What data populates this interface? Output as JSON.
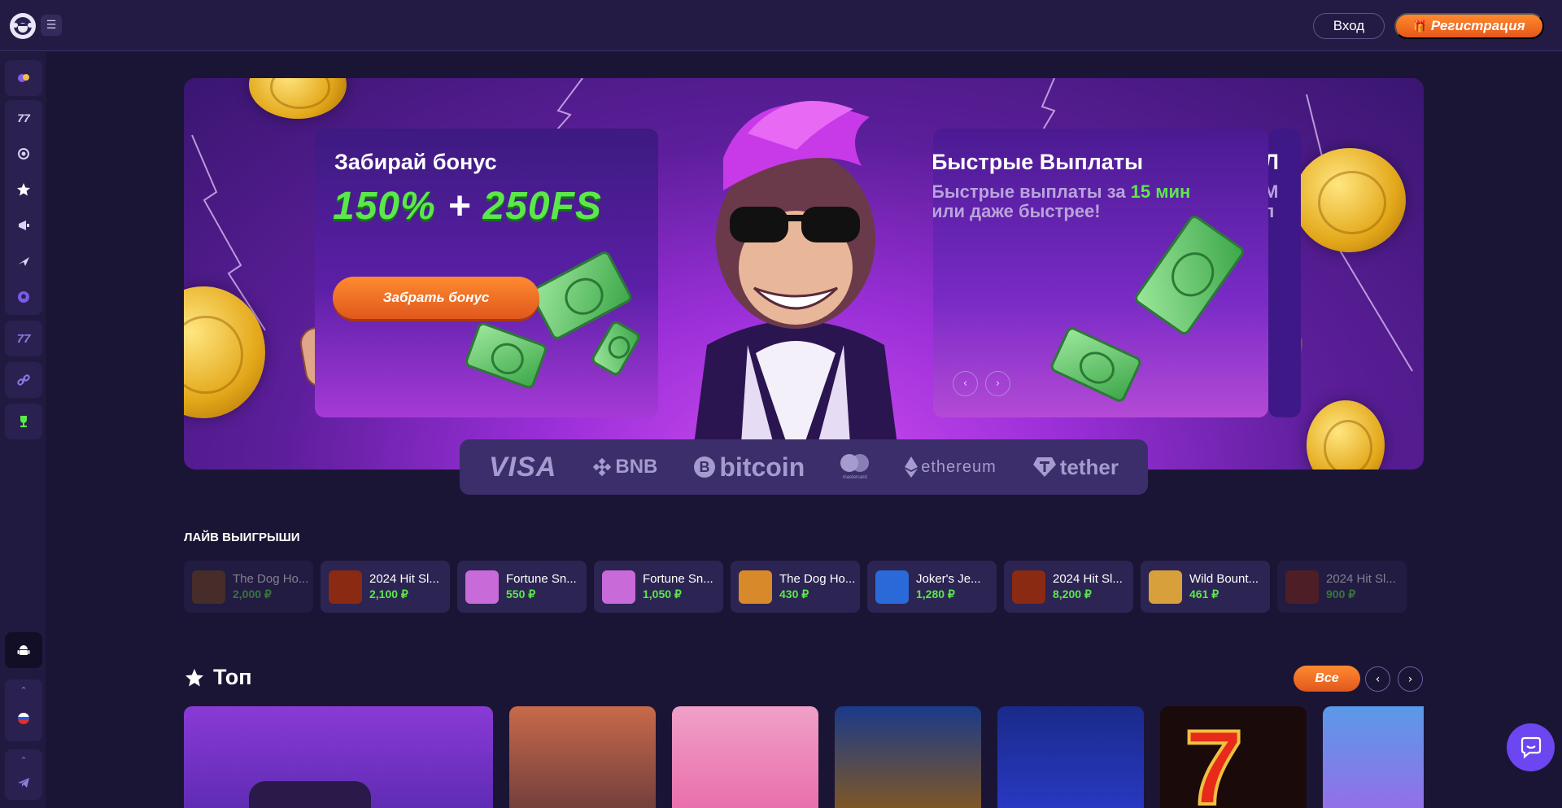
{
  "header": {
    "menu_icon": "hamburger-icon",
    "login_label": "Вход",
    "register_label": "Регистрация",
    "register_icon": "gift-icon"
  },
  "sidebar": {
    "items": [
      {
        "icon": "casino-chips-icon"
      },
      {
        "icon": "slots-777-icon"
      },
      {
        "icon": "live-casino-icon"
      },
      {
        "icon": "star-icon"
      },
      {
        "icon": "promotions-icon"
      },
      {
        "icon": "aviator-icon"
      },
      {
        "icon": "sports-ball-icon"
      },
      {
        "icon": "slots-77-icon"
      },
      {
        "icon": "link-icon"
      },
      {
        "icon": "trophy-icon"
      }
    ],
    "android_icon": "android-icon",
    "language_icon": "russian-flag-icon",
    "telegram_icon": "telegram-icon"
  },
  "banner": {
    "slide1": {
      "title": "Забирай бонус",
      "bonus_main": "150%",
      "bonus_plus": "+",
      "bonus_fs": "250FS",
      "cta": "Забрать бонус"
    },
    "slide2": {
      "title": "Быстрые Выплаты",
      "subtitle_part1": "Быстрые выплаты за ",
      "subtitle_highlight": "15 мин",
      "subtitle_part2": "или даже быстрее!"
    },
    "slide3_peek": {
      "title": "Л",
      "line1": "М",
      "line2": "п"
    },
    "arrows": {
      "prev": "‹",
      "next": "›"
    }
  },
  "payments": [
    {
      "name": "VISA"
    },
    {
      "name": "BNB"
    },
    {
      "name": "bitcoin"
    },
    {
      "name": "mastercard"
    },
    {
      "name": "ethereum"
    },
    {
      "name": "tether"
    }
  ],
  "live_wins": {
    "title": "ЛАЙВ ВЫИГРЫШИ",
    "items": [
      {
        "game": "The Dog Ho...",
        "amount": "2,000 ₽",
        "color": "#7a4a1e"
      },
      {
        "game": "2024 Hit Sl...",
        "amount": "2,100 ₽",
        "color": "#8a2a12"
      },
      {
        "game": "Fortune Sn...",
        "amount": "550 ₽",
        "color": "#c86ad8"
      },
      {
        "game": "Fortune Sn...",
        "amount": "1,050 ₽",
        "color": "#c86ad8"
      },
      {
        "game": "The Dog Ho...",
        "amount": "430 ₽",
        "color": "#d88a2a"
      },
      {
        "game": "Joker's Je...",
        "amount": "1,280 ₽",
        "color": "#2a6ad8"
      },
      {
        "game": "2024 Hit Sl...",
        "amount": "8,200 ₽",
        "color": "#8a2a12"
      },
      {
        "game": "Wild Bount...",
        "amount": "461 ₽",
        "color": "#d8a03a"
      },
      {
        "game": "2024 Hit Sl...",
        "amount": "900 ₽",
        "color": "#8a2a12"
      }
    ]
  },
  "top": {
    "title": "Топ",
    "all_label": "Все",
    "prev": "‹",
    "next": "›",
    "games": [
      {
        "color": "#8a3ad6"
      },
      {
        "color": "#c86a4a"
      },
      {
        "color": "#e86aa8"
      },
      {
        "color": "#1a3a8a"
      },
      {
        "color": "#2a3ac8"
      },
      {
        "color": "#1a0a0a"
      },
      {
        "color": "#5a9ae8"
      }
    ]
  },
  "chat_icon": "chat-bubble-icon"
}
